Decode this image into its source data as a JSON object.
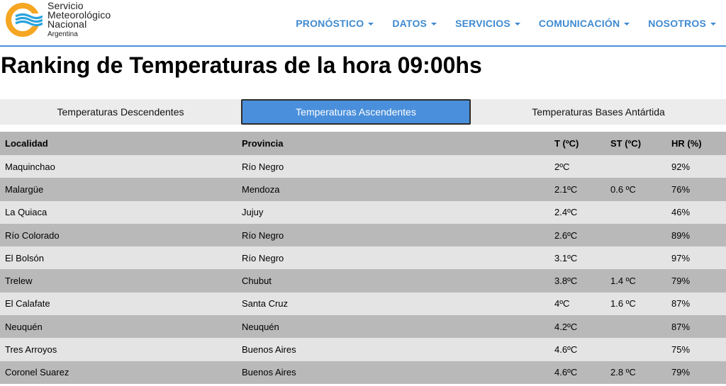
{
  "header": {
    "logo_lines": [
      "Servicio",
      "Meteorológico",
      "Nacional"
    ],
    "logo_sub": "Argentina",
    "nav": [
      "PRONÓSTICO",
      "DATOS",
      "SERVICIOS",
      "COMUNICACIÓN",
      "NOSOTROS"
    ]
  },
  "page_title": "Ranking de Temperaturas de la hora 09:00hs",
  "tabs": [
    {
      "label": "Temperaturas Descendentes",
      "active": false
    },
    {
      "label": "Temperaturas Ascendentes",
      "active": true
    },
    {
      "label": "Temperaturas Bases Antártida",
      "active": false
    }
  ],
  "table": {
    "headers": [
      "Localidad",
      "Provincia",
      "T (ºC)",
      "ST (ºC)",
      "HR (%)"
    ],
    "rows": [
      [
        "Maquinchao",
        "Río Negro",
        "2ºC",
        "",
        "92%"
      ],
      [
        "Malargüe",
        "Mendoza",
        "2.1ºC",
        "0.6 ºC",
        "76%"
      ],
      [
        "La Quiaca",
        "Jujuy",
        "2.4ºC",
        "",
        "46%"
      ],
      [
        "Río Colorado",
        "Río Negro",
        "2.6ºC",
        "",
        "89%"
      ],
      [
        "El Bolsón",
        "Río Negro",
        "3.1ºC",
        "",
        "97%"
      ],
      [
        "Trelew",
        "Chubut",
        "3.8ºC",
        "1.4 ºC",
        "79%"
      ],
      [
        "El Calafate",
        "Santa Cruz",
        "4ºC",
        "1.6 ºC",
        "87%"
      ],
      [
        "Neuquén",
        "Neuquén",
        "4.2ºC",
        "",
        "87%"
      ],
      [
        "Tres Arroyos",
        "Buenos Aires",
        "4.6ºC",
        "",
        "75%"
      ],
      [
        "Coronel Suarez",
        "Buenos Aires",
        "4.6ºC",
        "2.8 ºC",
        "79%"
      ]
    ]
  },
  "colors": {
    "accent": "#3f8ad1",
    "active_tab": "#4a8fdb",
    "logo_orange": "#f5a623",
    "logo_blue": "#29a3dd"
  }
}
